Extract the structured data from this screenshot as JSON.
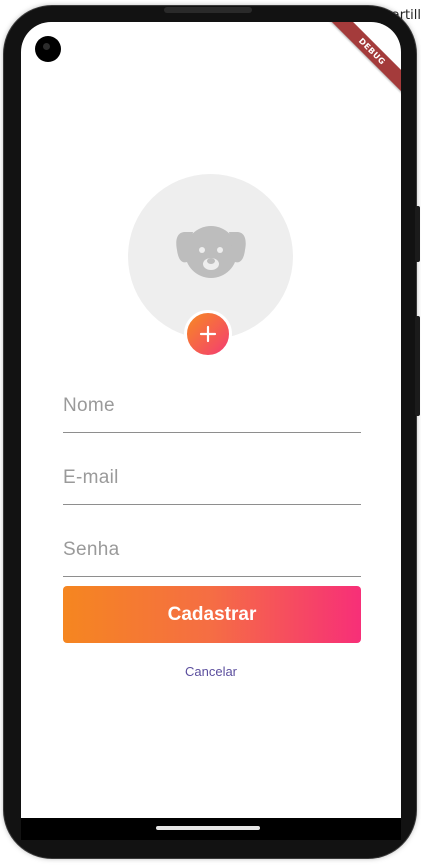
{
  "corner_label": "artill",
  "debug_banner": "DEBUG",
  "form": {
    "name_placeholder": "Nome",
    "email_placeholder": "E-mail",
    "password_placeholder": "Senha"
  },
  "actions": {
    "submit_label": "Cadastrar",
    "cancel_label": "Cancelar"
  },
  "icons": {
    "avatar_placeholder": "dog-face-icon",
    "add_photo": "plus-icon"
  },
  "colors": {
    "gradient_start": "#f58620",
    "gradient_end": "#f72f78",
    "cancel_link": "#5c4f9e",
    "avatar_bg": "#eeeeee",
    "debug_ribbon": "#a43b3b"
  }
}
